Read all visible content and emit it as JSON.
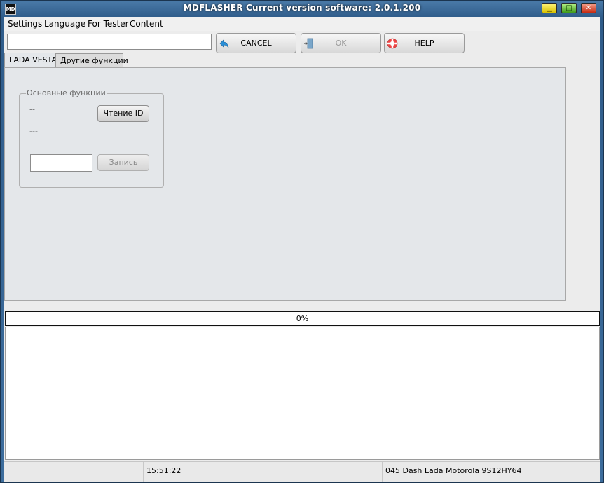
{
  "window": {
    "title": "MDFLASHER  Current version software: 2.0.1.200",
    "icon_text": "MD",
    "minimize_glyph": "▁",
    "maximize_glyph": "□",
    "close_glyph": "✕"
  },
  "menu": {
    "items": [
      {
        "label": "Settings"
      },
      {
        "label": "Language"
      },
      {
        "label": "For Tester"
      },
      {
        "label": "Content"
      }
    ]
  },
  "toolbar": {
    "input_value": "",
    "cancel_label": "CANCEL",
    "ok_label": "OK",
    "help_label": "HELP",
    "cancel_icon": "back-arrow-icon",
    "ok_icon": "door-exit-icon",
    "help_icon": "lifebuoy-icon"
  },
  "tabs": [
    {
      "label": "LADA VESTA",
      "active": true
    },
    {
      "label": "Другие функции",
      "active": false
    }
  ],
  "main_group": {
    "title": "Основные функции",
    "line1": "--",
    "line2": "---",
    "read_id_label": "Чтение ID",
    "write_label": "Запись",
    "input_value": ""
  },
  "progress": {
    "value": 0,
    "text": "0%"
  },
  "statusbar": {
    "cells": [
      {
        "text": ""
      },
      {
        "text": "15:51:22"
      },
      {
        "text": ""
      },
      {
        "text": ""
      },
      {
        "text": "045 Dash Lada Motorola 9S12HY64"
      }
    ]
  },
  "colors": {
    "title_bar": "#2f5c8a",
    "panel": "#e4e7ea",
    "progress_fill": "#3a8ee6"
  }
}
